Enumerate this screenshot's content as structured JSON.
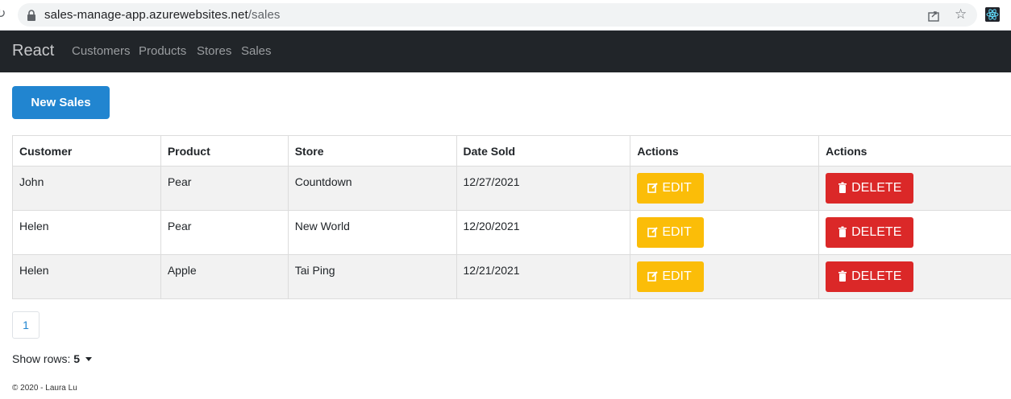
{
  "browser": {
    "url_host": "sales-manage-app.azurewebsites.net",
    "url_path": "/sales"
  },
  "navbar": {
    "brand": "React",
    "links": [
      "Customers",
      "Products",
      "Stores",
      "Sales"
    ]
  },
  "new_button_label": "New Sales",
  "table": {
    "headers": [
      "Customer",
      "Product",
      "Store",
      "Date Sold",
      "Actions",
      "Actions"
    ],
    "rows": [
      {
        "customer": "John",
        "product": "Pear",
        "store": "Countdown",
        "date": "12/27/2021"
      },
      {
        "customer": "Helen",
        "product": "Pear",
        "store": "New World",
        "date": "12/20/2021"
      },
      {
        "customer": "Helen",
        "product": "Apple",
        "store": "Tai Ping",
        "date": "12/21/2021"
      }
    ],
    "edit_label": "EDIT",
    "delete_label": "DELETE"
  },
  "pagination": {
    "current_page": "1"
  },
  "show_rows": {
    "label": "Show rows:",
    "value": "5"
  },
  "footer": "© 2020 - Laura Lu",
  "colors": {
    "navbar": "#212529",
    "primary": "#2185d0",
    "edit": "#fbbd08",
    "delete": "#db2828"
  }
}
